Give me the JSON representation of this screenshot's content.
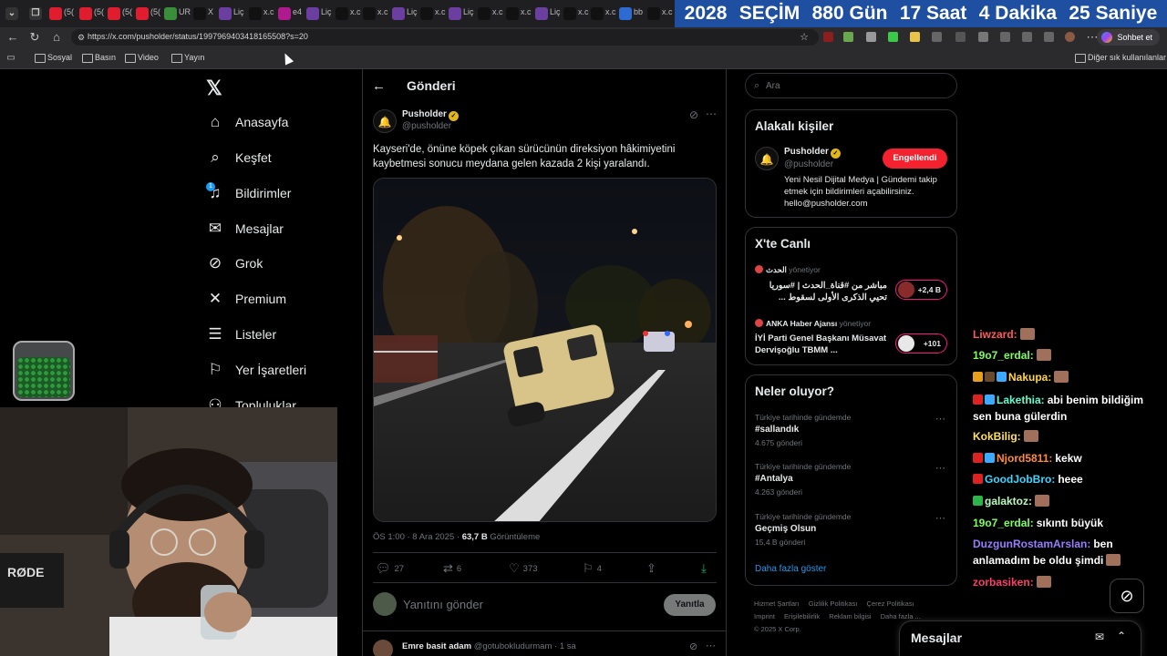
{
  "browser": {
    "tabs": [
      {
        "label": "(5(",
        "color": "#e01d2f"
      },
      {
        "label": "(5(",
        "color": "#e01d2f"
      },
      {
        "label": "(5(",
        "color": "#e01d2f"
      },
      {
        "label": "(5(",
        "color": "#e01d2f"
      },
      {
        "label": "UR",
        "color": "#3a8d3a"
      },
      {
        "label": "X",
        "color": "#111111"
      },
      {
        "label": "Liç",
        "color": "#6b3fa0"
      },
      {
        "label": "x.c",
        "color": "#111111"
      },
      {
        "label": "e4",
        "color": "#b01a8e"
      },
      {
        "label": "Liç",
        "color": "#6b3fa0"
      },
      {
        "label": "x.c",
        "color": "#111111"
      },
      {
        "label": "x.c",
        "color": "#111111"
      },
      {
        "label": "Liç",
        "color": "#6b3fa0"
      },
      {
        "label": "x.c",
        "color": "#111111"
      },
      {
        "label": "Liç",
        "color": "#6b3fa0"
      },
      {
        "label": "x.c",
        "color": "#111111"
      },
      {
        "label": "x.c",
        "color": "#111111"
      },
      {
        "label": "Liç",
        "color": "#6b3fa0"
      },
      {
        "label": "x.c",
        "color": "#111111"
      },
      {
        "label": "x.c",
        "color": "#111111"
      },
      {
        "label": "bb",
        "color": "#2d6bd3"
      },
      {
        "label": "x.c",
        "color": "#111111"
      }
    ],
    "countdown": [
      "2028",
      "SEÇİM",
      "880 Gün",
      "17 Saat",
      "4  Dakika",
      "25 Saniye"
    ],
    "url": "https://x.com/pusholder/status/1997969403418165508?s=20",
    "chat_button": "Sohbet et",
    "bookmarks": [
      "Sosyal",
      "Basın",
      "Video",
      "Yayın"
    ],
    "bookmarks_other": "Diğer sık kullanılanlar"
  },
  "nav": {
    "logo": "𝕏",
    "items": [
      {
        "label": "Anasayfa",
        "icon": "home-icon",
        "glyph": "⌂"
      },
      {
        "label": "Keşfet",
        "icon": "search-icon",
        "glyph": "⌕"
      },
      {
        "label": "Bildirimler",
        "icon": "bell-icon",
        "glyph": "♫",
        "badge": "1"
      },
      {
        "label": "Mesajlar",
        "icon": "mail-icon",
        "glyph": "✉"
      },
      {
        "label": "Grok",
        "icon": "grok-icon",
        "glyph": "⊘"
      },
      {
        "label": "Premium",
        "icon": "x-premium-icon",
        "glyph": "✕"
      },
      {
        "label": "Listeler",
        "icon": "list-icon",
        "glyph": "☰"
      },
      {
        "label": "Yer İşaretleri",
        "icon": "bookmark-icon",
        "glyph": "⚐"
      },
      {
        "label": "Topluluklar",
        "icon": "community-icon",
        "glyph": "⚇"
      }
    ]
  },
  "post": {
    "header_title": "Gönderi",
    "author_name": "Pusholder",
    "author_handle": "@pusholder",
    "text": "Kayseri'de, önüne köpek çıkan sürücünün direksiyon hâkimiyetini kaybetmesi sonucu meydana gelen kazada 2 kişi yaralandı.",
    "time": "ÖS 1:00 · 8 Ara 2025 · ",
    "views_value": "63,7 B",
    "views_label": " Görüntüleme",
    "replies": "27",
    "reposts": "6",
    "likes": "373",
    "bookmarks": "4",
    "reply_placeholder": "Yanıtını gönder",
    "reply_button": "Yanıtla"
  },
  "reply": {
    "name": "Emre basit adam",
    "handle": "@gotubokludurmam",
    "time": "· 1 sa"
  },
  "right": {
    "search_placeholder": "Ara",
    "related_title": "Alakalı kişiler",
    "related_name": "Pusholder",
    "related_handle": "@pusholder",
    "related_button": "Engellendi",
    "related_bio": "Yeni Nesil Dijital Medya | Gündemi takip etmek için bildirimleri açabilirsiniz. hello@pusholder.com",
    "live_title": "X'te Canlı",
    "live": [
      {
        "host": "الحدث",
        "status": "yönetiyor",
        "title": "مباشر من #قناة_الحدث | #سوريا تحيي الذكرى الأولى لسقوط ...",
        "count": "+2,4 B"
      },
      {
        "host": "ANKA Haber Ajansı",
        "status": "yönetiyor",
        "title": "İYİ Parti Genel Başkanı Müsavat Dervişoğlu TBMM ...",
        "count": "+101"
      }
    ],
    "trends_title": "Neler oluyor?",
    "trends": [
      {
        "category": "Türkiye tarihinde gündemde",
        "name": "#sallandık",
        "count": "4.675 gönderi"
      },
      {
        "category": "Türkiye tarihinde gündemde",
        "name": "#Antalya",
        "count": "4.263 gönderi"
      },
      {
        "category": "Türkiye tarihinde gündemde",
        "name": "Geçmiş Olsun",
        "count": "15,4 B gönderi"
      }
    ],
    "show_more": "Daha fazla göster",
    "footer": [
      "Hizmet Şartları",
      "Gizlilik Politikası",
      "Çerez Politikası",
      "Imprint",
      "Erişilebilirlik",
      "Reklam bilgisi",
      "Daha fazla ...",
      "© 2025 X Corp."
    ],
    "messages_title": "Mesajlar"
  },
  "chat": [
    {
      "user": "Liwzard:",
      "color": "#ff5a5a",
      "msg": ""
    },
    {
      "user": "19o7_erdal:",
      "color": "#7dff5a",
      "msg": ""
    },
    {
      "user": "Nakupa:",
      "color": "#ffd54a",
      "msg": ""
    },
    {
      "user": "Lakethia:",
      "color": "#5affd0",
      "msg": "abi benim bildiğim sen buna gülerdin"
    },
    {
      "user": "KokBilig:",
      "color": "#ffe066",
      "msg": ""
    },
    {
      "user": "Njord5811:",
      "color": "#ff8a3d",
      "msg": "kekw"
    },
    {
      "user": "GoodJobBro:",
      "color": "#3dd6ff",
      "msg": "heee"
    },
    {
      "user": "galaktoz:",
      "color": "#bdf7c0",
      "msg": ""
    },
    {
      "user": "19o7_erdal:",
      "color": "#7dff5a",
      "msg": "sıkıntı büyük"
    },
    {
      "user": "DuzgunRostamArslan:",
      "color": "#9a7dff",
      "msg": "ben anlamadım be oldu şimdi"
    },
    {
      "user": "zorbasiken:",
      "color": "#ff3d6a",
      "msg": ""
    }
  ],
  "colors": {
    "accent": "#1d9bf0",
    "blocked": "#f4212e",
    "live": "#f91880",
    "banner": "#1e4fa0"
  }
}
